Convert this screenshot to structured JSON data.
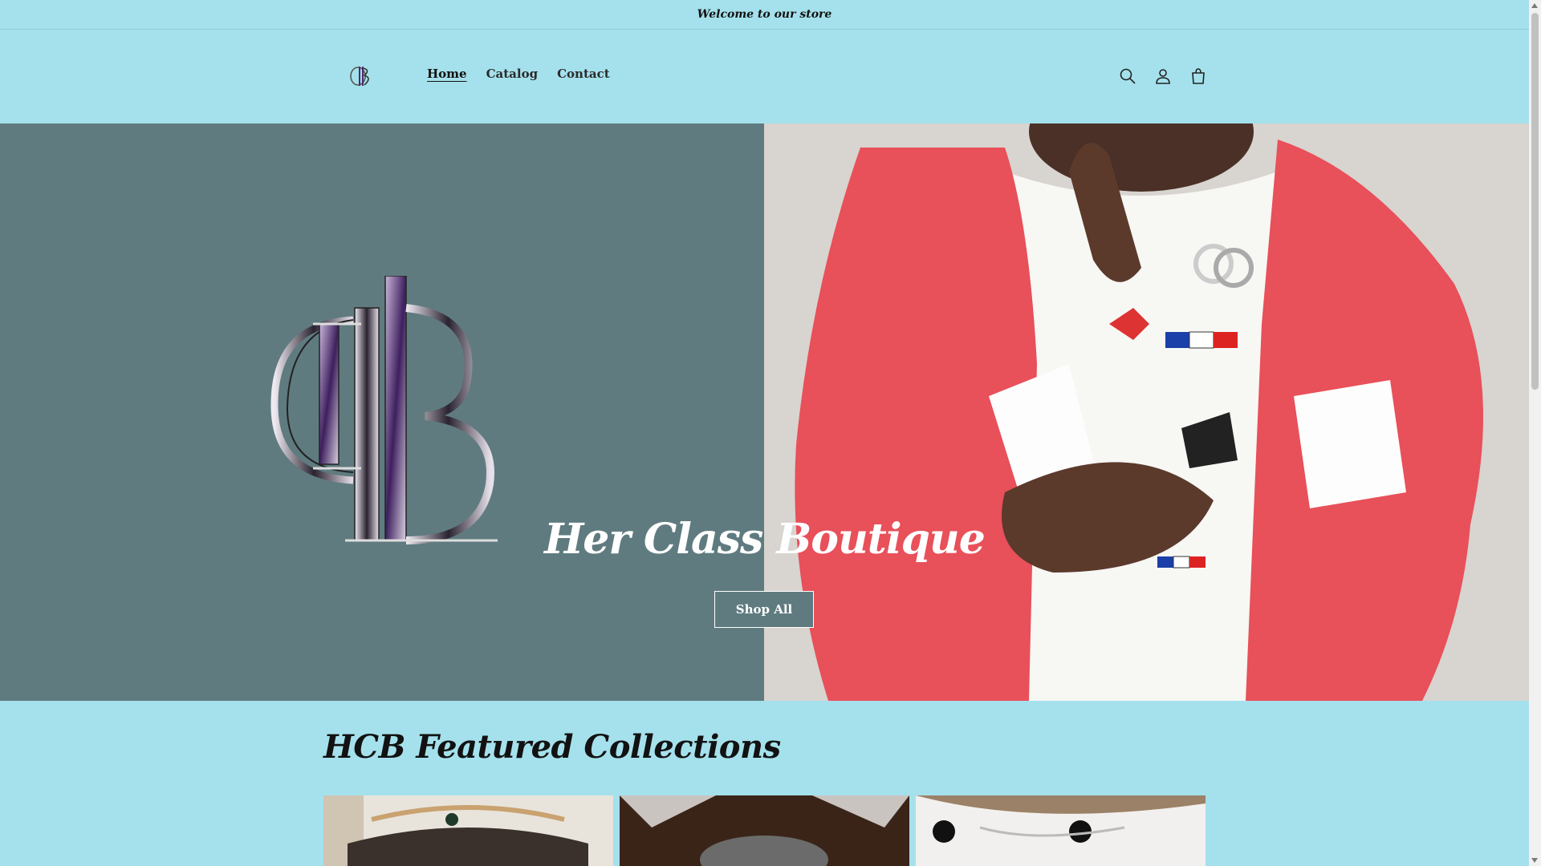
{
  "announcement": {
    "text": "Welcome to our store"
  },
  "header": {
    "logo_icon": "hcb-monogram-icon",
    "nav": [
      {
        "label": "Home",
        "active": true
      },
      {
        "label": "Catalog",
        "active": false
      },
      {
        "label": "Contact",
        "active": false
      }
    ],
    "icons": [
      "search-icon",
      "account-icon",
      "cart-icon"
    ]
  },
  "hero": {
    "title": "Her Class Boutique",
    "button_label": "Shop All",
    "left_panel_color": "#5f7b80"
  },
  "featured": {
    "title": "HCB Featured Collections"
  },
  "colors": {
    "page_background": "#a5e1ec",
    "jacket": "#e8505a"
  }
}
